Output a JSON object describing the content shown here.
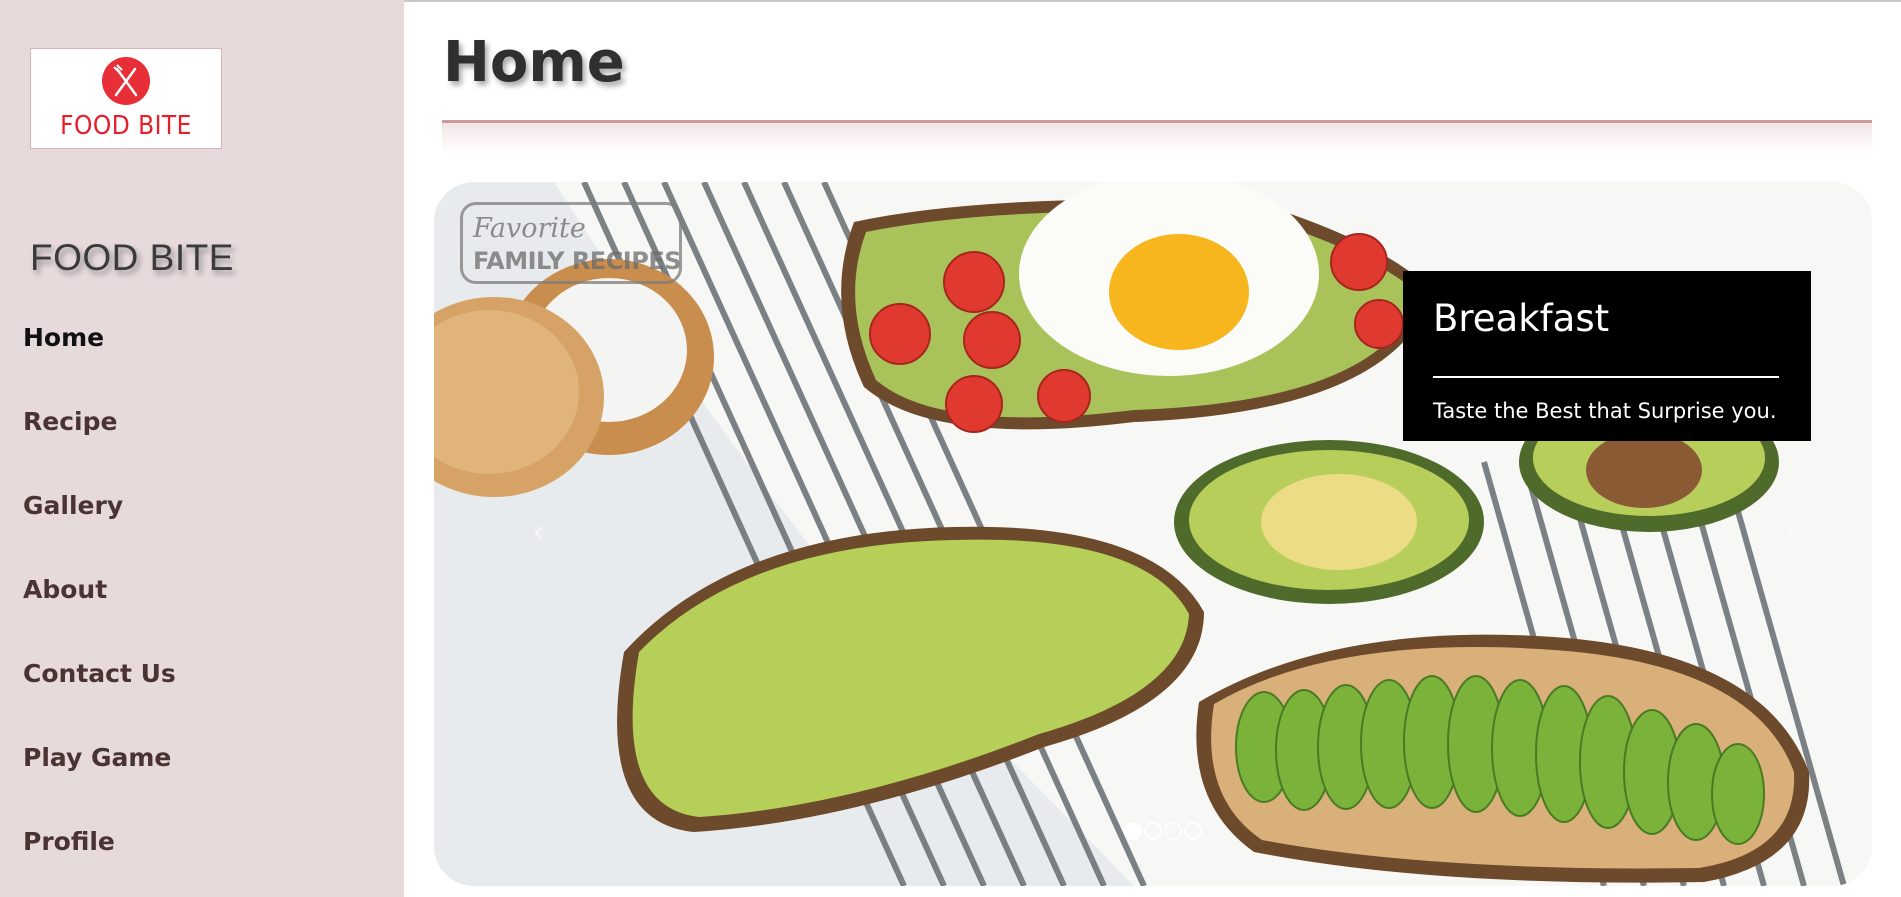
{
  "logo": {
    "text": "FOOD BITE",
    "icon": "fork-knife-icon",
    "color": "#e82e36"
  },
  "sidebar": {
    "brand": "FOOD BITE",
    "items": [
      {
        "label": "Home",
        "active": true
      },
      {
        "label": "Recipe",
        "active": false
      },
      {
        "label": "Gallery",
        "active": false
      },
      {
        "label": "About",
        "active": false
      },
      {
        "label": "Contact Us",
        "active": false
      },
      {
        "label": "Play Game",
        "active": false
      },
      {
        "label": "Profile",
        "active": false
      }
    ],
    "background": "#e6dadb"
  },
  "header": {
    "title": "Home"
  },
  "carousel": {
    "caption_title": "Breakfast",
    "caption_text": "Taste the Best that Surprise you.",
    "watermark_line1": "Favorite",
    "watermark_line2": "FAMILY RECIPES",
    "slide_count": 4,
    "active_slide": 1,
    "prev_icon": "chevron-left-icon",
    "next_icon": "chevron-right-icon"
  }
}
